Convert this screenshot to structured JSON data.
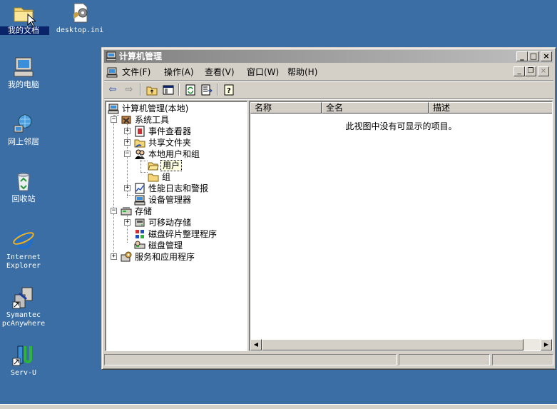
{
  "desktop": {
    "icons": [
      {
        "label": "我的文档"
      },
      {
        "label": "desktop.ini"
      },
      {
        "label": "我的电脑"
      },
      {
        "label": "网上邻居"
      },
      {
        "label": "回收站"
      },
      {
        "label": "Internet Explorer"
      },
      {
        "label": "Symantec pcAnywhere"
      },
      {
        "label": "Serv-U"
      }
    ]
  },
  "window": {
    "title": "计算机管理",
    "menus": [
      "文件(F)",
      "操作(A)",
      "查看(V)",
      "窗口(W)",
      "帮助(H)"
    ],
    "tree": [
      {
        "label": "计算机管理(本地)"
      },
      {
        "label": "系统工具"
      },
      {
        "label": "事件查看器"
      },
      {
        "label": "共享文件夹"
      },
      {
        "label": "本地用户和组"
      },
      {
        "label": "用户"
      },
      {
        "label": "组"
      },
      {
        "label": "性能日志和警报"
      },
      {
        "label": "设备管理器"
      },
      {
        "label": "存储"
      },
      {
        "label": "可移动存储"
      },
      {
        "label": "磁盘碎片整理程序"
      },
      {
        "label": "磁盘管理"
      },
      {
        "label": "服务和应用程序"
      }
    ],
    "list": {
      "columns": [
        "名称",
        "全名",
        "描述"
      ],
      "empty_message": "此视图中没有可显示的项目。"
    }
  },
  "colors": {
    "desktop": "#3a6ea5",
    "titlebar_inactive": "#808080",
    "face": "#d4d0c8"
  }
}
